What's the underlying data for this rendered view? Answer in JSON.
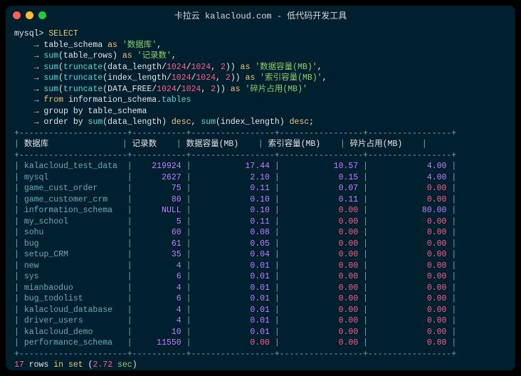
{
  "window": {
    "title": "卡拉云 kalacloud.com - 低代码开发工具"
  },
  "prompt": "mysql>",
  "arrow": "→",
  "sql": {
    "select": "SELECT",
    "line1_a": "table_schema",
    "line1_as": "as",
    "line1_b": "'数据库'",
    "line2_a": "sum",
    "line2_b": "(table_rows)",
    "line2_as": "as",
    "line2_c": "'记录数'",
    "line3_a": "sum",
    "line3_b": "(",
    "line3_c": "truncate",
    "line3_d": "(data_length/",
    "line3_e": "1024",
    "line3_f": "/",
    "line3_g": "1024",
    "line3_h": ", ",
    "line3_i": "2",
    "line3_j": "))",
    "line3_as": "as",
    "line3_k": "'数据容量(MB)'",
    "line4_a": "sum",
    "line4_b": "(",
    "line4_c": "truncate",
    "line4_d": "(index_length/",
    "line4_e": "1024",
    "line4_f": "/",
    "line4_g": "1024",
    "line4_h": ", ",
    "line4_i": "2",
    "line4_j": "))",
    "line4_as": "as",
    "line4_k": "'索引容量(MB)'",
    "line5_a": "sum",
    "line5_b": "(",
    "line5_c": "truncate",
    "line5_d": "(DATA_FREE/",
    "line5_e": "1024",
    "line5_f": "/",
    "line5_g": "1024",
    "line5_h": ", ",
    "line5_i": "2",
    "line5_j": "))",
    "line5_as": "as",
    "line5_k": "'碎片占用(MB)'",
    "line6_a": "from",
    "line6_b": "information_schema.",
    "line6_c": "tables",
    "line7_a": "group by table_schema",
    "line8_a": "order by sum",
    "line8_b": "(data_length)",
    "line8_c": "desc",
    "line8_d": ", ",
    "line8_e": "sum",
    "line8_f": "(index_length)",
    "line8_g": "desc",
    "line8_h": ";"
  },
  "table": {
    "headers": [
      "数据库",
      "记录数",
      "数据容量(MB)",
      "索引容量(MB)",
      "碎片占用(MB)"
    ],
    "rows": [
      {
        "db": "kalacloud_test_data",
        "rec": "219924",
        "data": "17.44",
        "idx": "10.57",
        "frag": "4.00"
      },
      {
        "db": "mysql",
        "rec": "2627",
        "data": "2.10",
        "idx": "0.15",
        "frag": "4.00"
      },
      {
        "db": "game_cust_order",
        "rec": "75",
        "data": "0.11",
        "idx": "0.07",
        "frag": "0.00"
      },
      {
        "db": "game_customer_crm",
        "rec": "80",
        "data": "0.10",
        "idx": "0.11",
        "frag": "0.00"
      },
      {
        "db": "information_schema",
        "rec": "NULL",
        "data": "0.10",
        "idx": "0.00",
        "frag": "80.00"
      },
      {
        "db": "my_school",
        "rec": "5",
        "data": "0.11",
        "idx": "0.00",
        "frag": "0.00"
      },
      {
        "db": "sohu",
        "rec": "60",
        "data": "0.08",
        "idx": "0.00",
        "frag": "0.00"
      },
      {
        "db": "bug",
        "rec": "61",
        "data": "0.05",
        "idx": "0.00",
        "frag": "0.00"
      },
      {
        "db": "setup_CRM",
        "rec": "35",
        "data": "0.04",
        "idx": "0.00",
        "frag": "0.00"
      },
      {
        "db": "new",
        "rec": "4",
        "data": "0.01",
        "idx": "0.00",
        "frag": "0.00"
      },
      {
        "db": "sys",
        "rec": "6",
        "data": "0.01",
        "idx": "0.00",
        "frag": "0.00"
      },
      {
        "db": "mianbaoduo",
        "rec": "4",
        "data": "0.01",
        "idx": "0.00",
        "frag": "0.00"
      },
      {
        "db": "bug_todolist",
        "rec": "6",
        "data": "0.01",
        "idx": "0.00",
        "frag": "0.00"
      },
      {
        "db": "kalacloud_database",
        "rec": "4",
        "data": "0.01",
        "idx": "0.00",
        "frag": "0.00"
      },
      {
        "db": "driver_users",
        "rec": "4",
        "data": "0.01",
        "idx": "0.00",
        "frag": "0.00"
      },
      {
        "db": "kalacloud_demo",
        "rec": "10",
        "data": "0.01",
        "idx": "0.00",
        "frag": "0.00"
      },
      {
        "db": "performance_schema",
        "rec": "11550",
        "data": "0.00",
        "idx": "0.00",
        "frag": "0.00"
      }
    ]
  },
  "footer": {
    "rows_num": "17",
    "rows_word": "rows",
    "in_word": "in",
    "set_word": "set",
    "paren_open": "(",
    "time": "2.72",
    "sec": "sec",
    "paren_close": ")"
  }
}
